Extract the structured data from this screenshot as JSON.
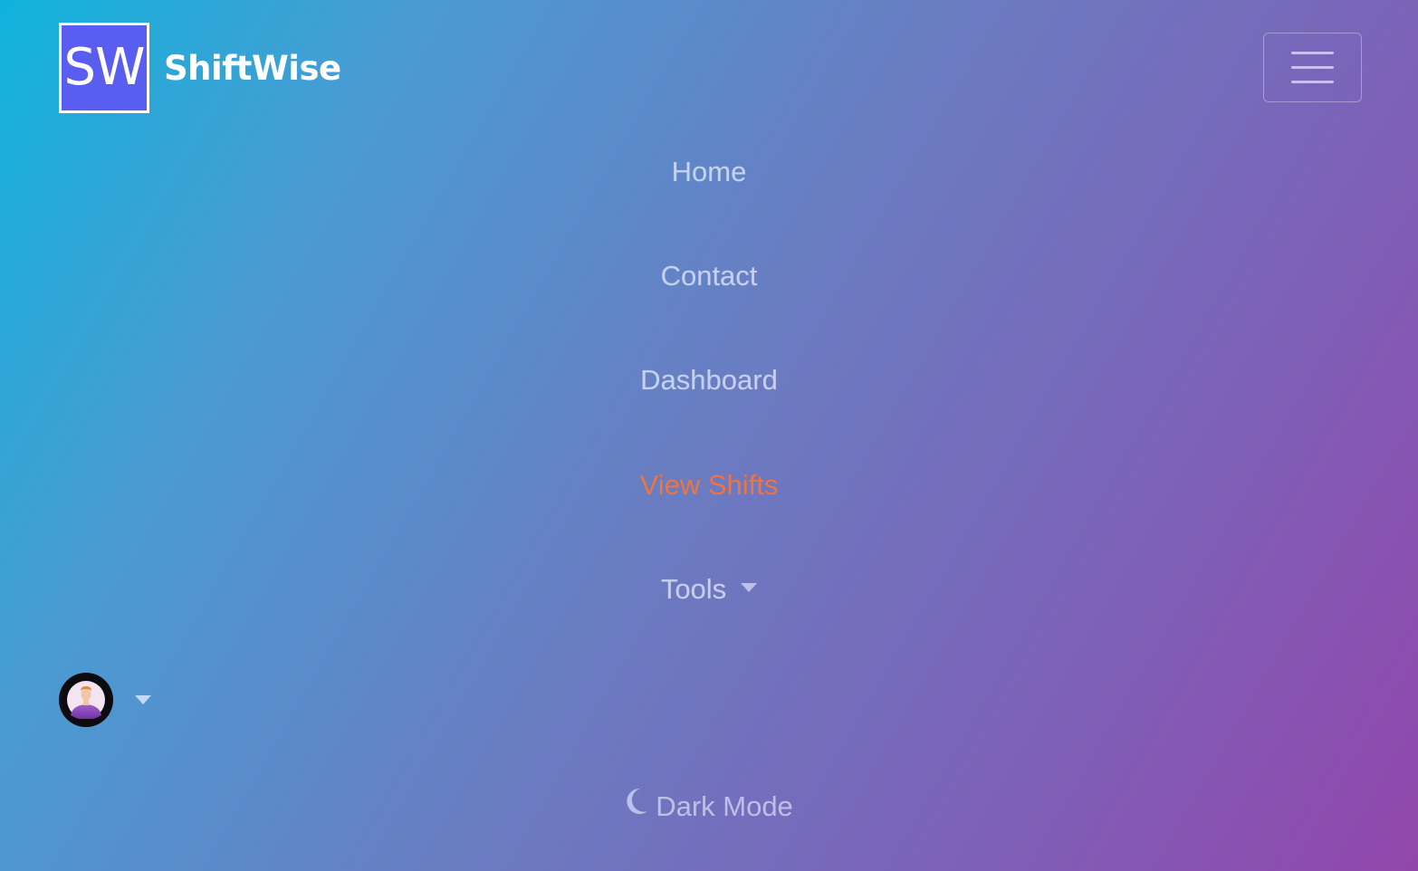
{
  "brand": {
    "logo_text": "SW",
    "name": "ShiftWise"
  },
  "header": {
    "menu_toggle_icon": "hamburger-icon"
  },
  "nav": {
    "items": [
      {
        "label": "Home",
        "active": false
      },
      {
        "label": "Contact",
        "active": false
      },
      {
        "label": "Dashboard",
        "active": false
      },
      {
        "label": "View Shifts",
        "active": true
      },
      {
        "label": "Tools",
        "active": false,
        "has_dropdown": true
      }
    ]
  },
  "user": {
    "avatar_icon": "user-avatar",
    "dropdown_icon": "caret-down-icon"
  },
  "theme_toggle": {
    "icon": "moon-icon",
    "label": "Dark Mode"
  },
  "colors": {
    "gradient_start": "#0fb3dc",
    "gradient_end": "#9246ac",
    "logo_bg": "#5a5ef0",
    "active_link": "#f0743e"
  }
}
